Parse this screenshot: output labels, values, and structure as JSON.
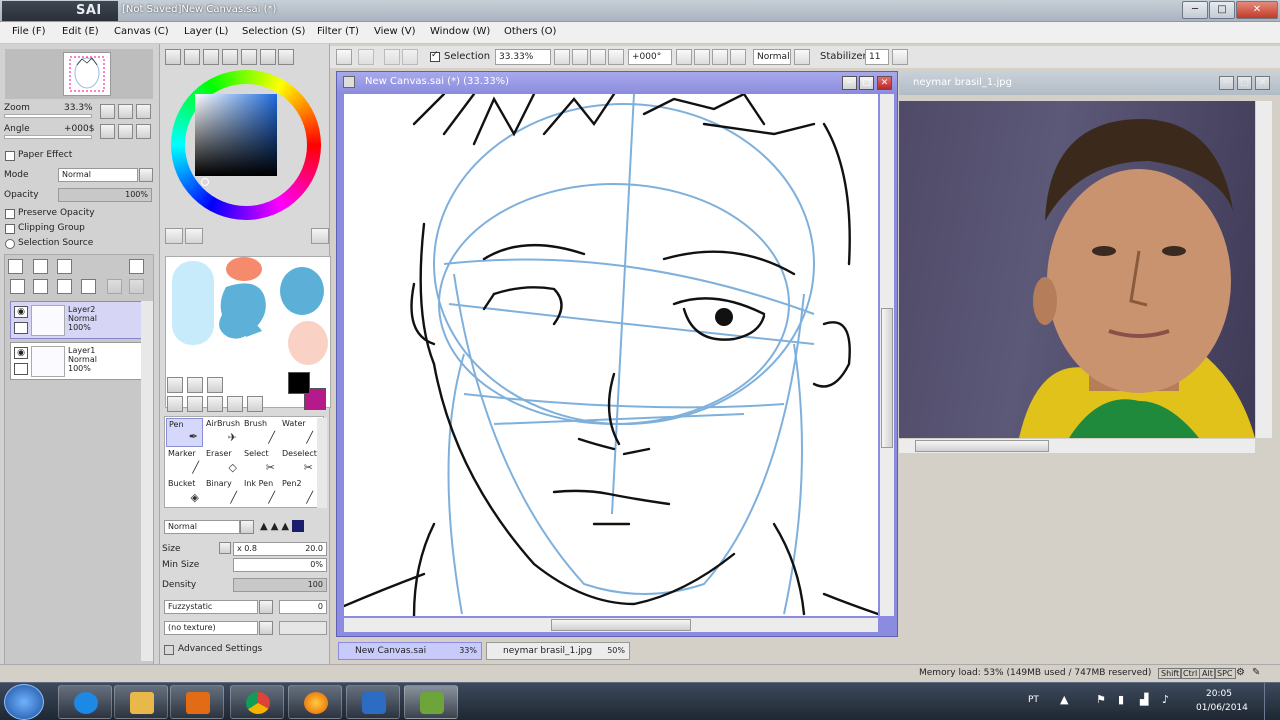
{
  "window": {
    "app_name": "SAI",
    "title": "[Not Saved]New Canvas.sai (*)"
  },
  "menu": [
    "File (F)",
    "Edit (E)",
    "Canvas (C)",
    "Layer (L)",
    "Selection (S)",
    "Filter (T)",
    "View (V)",
    "Window (W)",
    "Others (O)"
  ],
  "toolbar": {
    "selection_label": "Selection",
    "zoom_value": "33.33%",
    "angle_value": "+000°",
    "blend_mode": "Normal",
    "stabilizer_label": "Stabilizer",
    "stabilizer_value": "11"
  },
  "navigator": {
    "zoom_label": "Zoom",
    "zoom_value": "33.3%",
    "angle_label": "Angle",
    "angle_value": "+000$"
  },
  "layer_panel": {
    "paper_effect": "Paper Effect",
    "mode_label": "Mode",
    "mode_value": "Normal",
    "opacity_label": "Opacity",
    "opacity_value": "100%",
    "preserve_opacity": "Preserve Opacity",
    "clipping_group": "Clipping Group",
    "selection_source": "Selection Source",
    "layers": [
      {
        "name": "Layer2",
        "mode": "Normal",
        "opacity": "100%",
        "selected": true
      },
      {
        "name": "Layer1",
        "mode": "Normal",
        "opacity": "100%",
        "selected": false
      }
    ]
  },
  "tools": [
    {
      "label": "Pen",
      "glyph": "✒",
      "active": true
    },
    {
      "label": "AirBrush",
      "glyph": "✈",
      "active": false
    },
    {
      "label": "Brush",
      "glyph": "╱",
      "active": false
    },
    {
      "label": "Water",
      "glyph": "╱",
      "active": false
    },
    {
      "label": "Marker",
      "glyph": "╱",
      "active": false
    },
    {
      "label": "Eraser",
      "glyph": "◇",
      "active": false
    },
    {
      "label": "Select",
      "glyph": "✂",
      "active": false
    },
    {
      "label": "Deselect",
      "glyph": "✂",
      "active": false
    },
    {
      "label": "Bucket",
      "glyph": "◈",
      "active": false
    },
    {
      "label": "Binary",
      "glyph": "╱",
      "active": false
    },
    {
      "label": "Ink Pen",
      "glyph": "╱",
      "active": false
    },
    {
      "label": "Pen2",
      "glyph": "╱",
      "active": false
    }
  ],
  "brush": {
    "blend_mode": "Normal",
    "size_label": "Size",
    "size_mult": "x 0.8",
    "size_value": "20.0",
    "min_size_label": "Min Size",
    "min_size_value": "0%",
    "density_label": "Density",
    "density_value": "100",
    "shape": "Fuzzystatic",
    "shape_value": "0",
    "texture": "(no texture)",
    "advanced_settings": "Advanced Settings"
  },
  "colors": {
    "accent": "#8b8cdf",
    "foreground": "#000000",
    "background": "#b5198a",
    "swatches": [
      "#c7ebfb",
      "#f58b6c",
      "#5db1d8",
      "#5cb0d8",
      "#f9d2c5"
    ]
  },
  "canvas_window": {
    "title": "New Canvas.sai (*) (33.33%)"
  },
  "reference_window": {
    "title": "neymar brasil_1.jpg"
  },
  "tabs": [
    {
      "label": "New Canvas.sai",
      "pct": "33%"
    },
    {
      "label": "neymar brasil_1.jpg",
      "pct": "50%"
    }
  ],
  "status": {
    "memory": "Memory load: 53% (149MB used / 747MB reserved)",
    "keys": [
      "Shift",
      "Ctrl",
      "Alt",
      "SPC"
    ]
  },
  "taskbar": {
    "apps": [
      {
        "name": "internet-explorer",
        "color": "#1e88e5"
      },
      {
        "name": "file-explorer",
        "color": "#e8b84a"
      },
      {
        "name": "media-player",
        "color": "#e26b16"
      },
      {
        "name": "chrome",
        "color": "#3aa757"
      },
      {
        "name": "firefox",
        "color": "#ff7c1b"
      },
      {
        "name": "app-blue",
        "color": "#2c6cc2"
      },
      {
        "name": "paint-tool-sai",
        "color": "#6da53a"
      }
    ],
    "language": "PT",
    "time": "20:05",
    "date": "01/06/2014"
  }
}
